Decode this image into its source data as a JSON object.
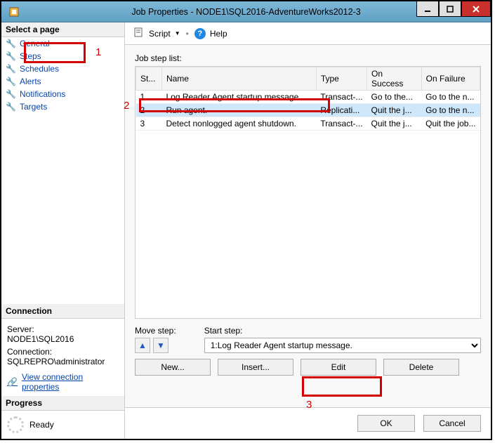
{
  "window": {
    "title": "Job Properties - NODE1\\SQL2016-AdventureWorks2012-3"
  },
  "sidebar": {
    "select_page": "Select a page",
    "pages": [
      {
        "label": "General"
      },
      {
        "label": "Steps"
      },
      {
        "label": "Schedules"
      },
      {
        "label": "Alerts"
      },
      {
        "label": "Notifications"
      },
      {
        "label": "Targets"
      }
    ],
    "connection_header": "Connection",
    "server_label": "Server:",
    "server_value": "NODE1\\SQL2016",
    "conn_label": "Connection:",
    "conn_value": "SQLREPRO\\administrator",
    "view_conn": "View connection properties",
    "progress_header": "Progress",
    "progress_status": "Ready"
  },
  "toolbar": {
    "script": "Script",
    "help": "Help"
  },
  "main": {
    "list_label": "Job step list:",
    "columns": {
      "st": "St...",
      "name": "Name",
      "type": "Type",
      "success": "On Success",
      "failure": "On Failure"
    },
    "rows": [
      {
        "st": "1",
        "name": "Log Reader Agent startup message.",
        "type": "Transact-...",
        "success": "Go to the...",
        "failure": "Go to the n..."
      },
      {
        "st": "2",
        "name": "Run agent.",
        "type": "Replicati...",
        "success": "Quit the j...",
        "failure": "Go to the n..."
      },
      {
        "st": "3",
        "name": "Detect nonlogged agent shutdown.",
        "type": "Transact-...",
        "success": "Quit the j...",
        "failure": "Quit the job..."
      }
    ],
    "selected_row_index": 1,
    "move_step_label": "Move step:",
    "start_step_label": "Start step:",
    "start_step_value": "1:Log Reader Agent startup message.",
    "buttons": {
      "new": "New...",
      "insert": "Insert...",
      "edit": "Edit",
      "delete": "Delete"
    }
  },
  "dialog": {
    "ok": "OK",
    "cancel": "Cancel"
  },
  "annotations": {
    "n1": "1",
    "n2": "2",
    "n3": "3"
  }
}
